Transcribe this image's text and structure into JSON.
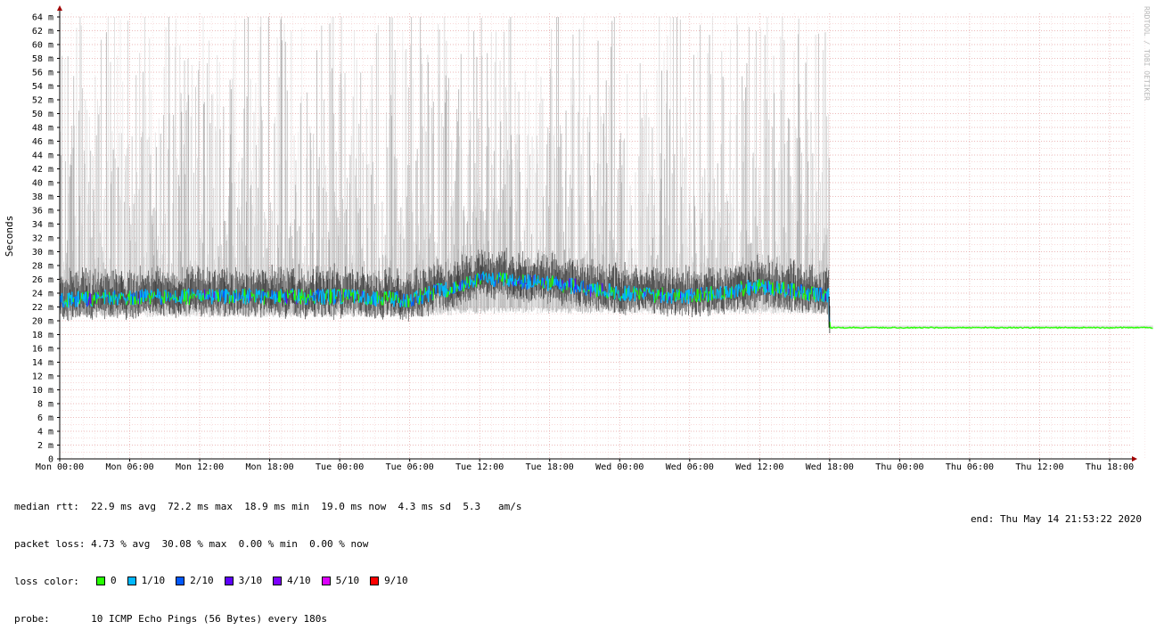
{
  "chart_data": {
    "type": "line",
    "ylabel": "Seconds",
    "watermark": "RRDTOOL / TOBI OETIKER",
    "yunit": "m",
    "ylim": [
      0,
      65
    ],
    "yticks": [
      0,
      2,
      4,
      6,
      8,
      10,
      12,
      14,
      16,
      18,
      20,
      22,
      24,
      26,
      28,
      30,
      32,
      34,
      36,
      38,
      40,
      42,
      44,
      46,
      48,
      50,
      52,
      54,
      56,
      58,
      60,
      62,
      64
    ],
    "xlim_hours": [
      0,
      94
    ],
    "xticks": [
      {
        "label": "Mon 00:00",
        "h": 0
      },
      {
        "label": "Mon 06:00",
        "h": 6
      },
      {
        "label": "Mon 12:00",
        "h": 12
      },
      {
        "label": "Mon 18:00",
        "h": 18
      },
      {
        "label": "Tue 00:00",
        "h": 24
      },
      {
        "label": "Tue 06:00",
        "h": 30
      },
      {
        "label": "Tue 12:00",
        "h": 36
      },
      {
        "label": "Tue 18:00",
        "h": 42
      },
      {
        "label": "Wed 00:00",
        "h": 48
      },
      {
        "label": "Wed 06:00",
        "h": 54
      },
      {
        "label": "Wed 12:00",
        "h": 60
      },
      {
        "label": "Wed 18:00",
        "h": 66
      },
      {
        "label": "Thu 00:00",
        "h": 72
      },
      {
        "label": "Thu 06:00",
        "h": 78
      },
      {
        "label": "Thu 12:00",
        "h": 84
      },
      {
        "label": "Thu 18:00",
        "h": 90
      }
    ],
    "grid": true,
    "series": [
      {
        "segments": [
          {
            "h": 0,
            "median": 23.0,
            "spread_low": 20.5,
            "spread_high": 64
          },
          {
            "h": 6,
            "median": 23.5,
            "spread_low": 20.5,
            "spread_high": 64
          },
          {
            "h": 12,
            "median": 23.5,
            "spread_low": 20.5,
            "spread_high": 64
          },
          {
            "h": 18,
            "median": 23.5,
            "spread_low": 20.5,
            "spread_high": 64
          },
          {
            "h": 24,
            "median": 23.5,
            "spread_low": 20.5,
            "spread_high": 64
          },
          {
            "h": 30,
            "median": 23.0,
            "spread_low": 20.5,
            "spread_high": 64
          },
          {
            "h": 36,
            "median": 26.0,
            "spread_low": 21.0,
            "spread_high": 64
          },
          {
            "h": 42,
            "median": 25.5,
            "spread_low": 21.0,
            "spread_high": 64
          },
          {
            "h": 48,
            "median": 24.0,
            "spread_low": 21.0,
            "spread_high": 64
          },
          {
            "h": 54,
            "median": 23.5,
            "spread_low": 21.0,
            "spread_high": 64
          },
          {
            "h": 60,
            "median": 25.0,
            "spread_low": 21.0,
            "spread_high": 64
          },
          {
            "h": 65.9,
            "median": 23.5,
            "spread_low": 21.0,
            "spread_high": 64
          },
          {
            "h": 66,
            "median": 19.0,
            "spread_low": 18.9,
            "spread_high": 19.3
          },
          {
            "h": 93.7,
            "median": 19.0,
            "spread_low": 18.9,
            "spread_high": 19.3
          }
        ]
      }
    ]
  },
  "stats": {
    "median_rtt": "median rtt:  22.9 ms avg  72.2 ms max  18.9 ms min  19.0 ms now  4.3 ms sd  5.3   am/s",
    "packet_loss": "packet loss: 4.73 % avg  30.08 % max  0.00 % min  0.00 % now",
    "loss_color_label": "loss color:",
    "loss_colors": [
      {
        "label": "0",
        "color": "#26ff00"
      },
      {
        "label": "1/10",
        "color": "#00b8ff"
      },
      {
        "label": "2/10",
        "color": "#0059ff"
      },
      {
        "label": "3/10",
        "color": "#5e00ff"
      },
      {
        "label": "4/10",
        "color": "#7e00ff"
      },
      {
        "label": "5/10",
        "color": "#dd00ff"
      },
      {
        "label": "9/10",
        "color": "#ff0000"
      }
    ],
    "probe": "probe:       10 ICMP Echo Pings (56 Bytes) every 180s",
    "end": "end: Thu May 14 21:53:22 2020"
  }
}
